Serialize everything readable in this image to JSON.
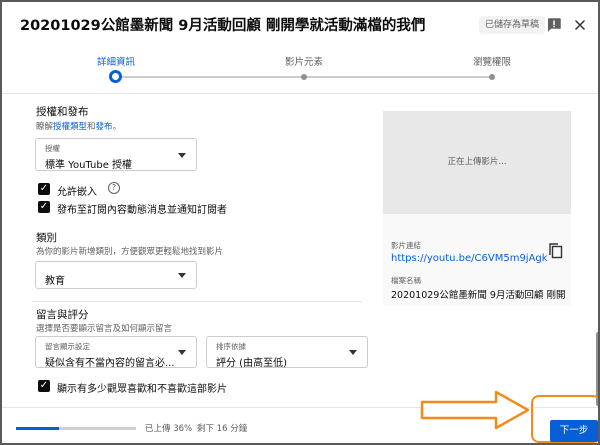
{
  "header": {
    "title": "20201029公館墨新聞 9月活動回顧 剛開學就活動滿檔的我們",
    "draft_badge": "已儲存為草稿",
    "feedback_icon": "feedback-icon",
    "close_icon": "close-icon"
  },
  "stepper": {
    "steps": [
      {
        "label": "詳細資訊",
        "active": true
      },
      {
        "label": "影片元素",
        "active": false
      },
      {
        "label": "瀏覽權限",
        "active": false
      }
    ]
  },
  "license": {
    "title": "授權和發布",
    "desc_prefix": "瞭解",
    "desc_link1": "授權類型",
    "desc_mid": "和",
    "desc_link2": "發布",
    "desc_suffix": "。",
    "select_label": "授權",
    "select_value": "標準 YouTube 授權"
  },
  "checkboxes": {
    "embed": "允許嵌入",
    "notify": "發布至訂閱內容動態消息並通知訂閱者"
  },
  "category": {
    "title": "類別",
    "desc": "為你的影片新增類別，方便觀眾更輕鬆地找到影片",
    "value": "教育"
  },
  "comments": {
    "title": "留言與評分",
    "desc": "選擇是否要顯示留言及如何顯示留言",
    "visibility_label": "留言顯示設定",
    "visibility_value": "疑似含有不當內容的留言必...",
    "sort_label": "排序依據",
    "sort_value": "評分 (由高至低)",
    "ratings_checkbox": "顯示有多少觀眾喜歡和不喜歡這部影片"
  },
  "preview": {
    "uploading_text": "正在上傳影片...",
    "link_label": "影片連結",
    "link": "https://youtu.be/C6VM5m9jAgk",
    "file_label": "檔案名稱",
    "file_name": "20201029公館墨新聞 9月活動回顧 剛開學就活動滿檔的我們"
  },
  "footer": {
    "progress_percent": 36,
    "uploaded_text": "已上傳 36%",
    "remaining_text": "剩下 16 分鐘",
    "next_label": "下一步"
  },
  "colors": {
    "accent": "#065fd4",
    "annotation": "#f08c1e"
  }
}
